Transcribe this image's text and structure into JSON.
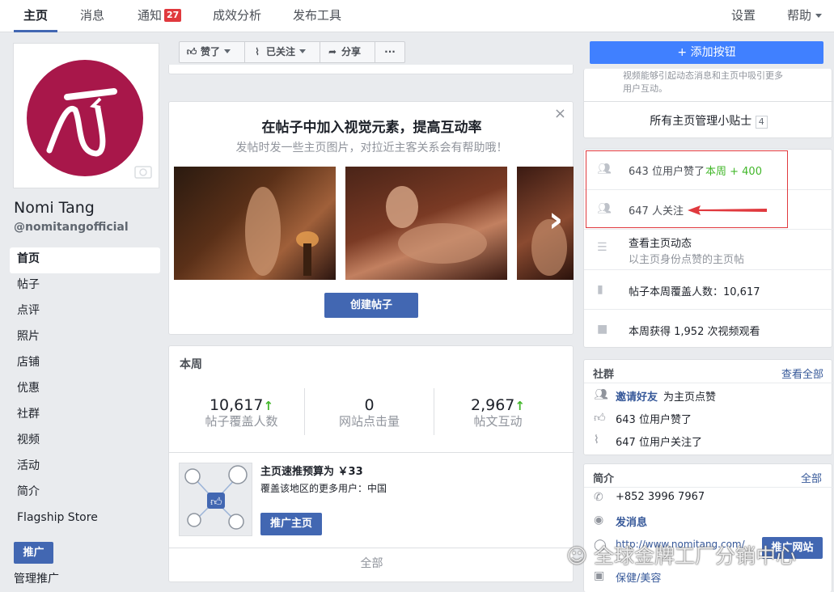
{
  "topnav": {
    "tabs": [
      "主页",
      "消息",
      "通知",
      "成效分析",
      "发布工具"
    ],
    "notif_count": "27",
    "settings": "设置",
    "help": "帮助"
  },
  "page": {
    "name": "Nomi Tang",
    "handle": "@nomitangofficial",
    "nav": [
      "首页",
      "帖子",
      "点评",
      "照片",
      "店铺",
      "优惠",
      "社群",
      "视频",
      "活动",
      "简介",
      "Flagship Store"
    ],
    "promote_button": "推广",
    "manage_promotions": "管理推广"
  },
  "actions": {
    "liked": "赞了",
    "following": "已关注",
    "share": "分享",
    "more": "···"
  },
  "add_button": "+ 添加按钮",
  "visual_card": {
    "title": "在帖子中加入视觉元素，提高互动率",
    "subtitle": "发帖时发一些主页图片，对拉近主客关系会有帮助哦！",
    "create_post": "创建帖子",
    "close": "×",
    "next": "›"
  },
  "week": {
    "header": "本周",
    "stats": [
      {
        "value": "10,617",
        "label": "帖子覆盖人数",
        "up": "↑"
      },
      {
        "value": "0",
        "label": "网站点击量",
        "up": ""
      },
      {
        "value": "2,967",
        "label": "帖文互动",
        "up": "↑"
      }
    ],
    "boost_title": "主页速推预算为 ￥33",
    "boost_desc": "覆盖该地区的更多用户：中国",
    "boost_button": "推广主页",
    "see_all": "全部"
  },
  "tips": {
    "partial_text_1": "视频能够引起动态消息和主页中吸引更多",
    "partial_text_2": "用户互动。",
    "all_tips": "所有主页管理小贴士",
    "tips_count": "4"
  },
  "insights": {
    "likes": "643 位用户赞了",
    "likes_week": "本周 + 400",
    "followers": "647 人关注",
    "activity_title": "查看主页动态",
    "activity_sub": "以主页身份点赞的主页帖",
    "reach": "帖子本周覆盖人数：10,617",
    "video": "本周获得 1,952 次视频观看"
  },
  "community": {
    "header": "社群",
    "see_all": "查看全部",
    "invite": "邀请好友",
    "invite_suffix": "为主页点赞",
    "likes": "643 位用户赞了",
    "follows": "647 位用户关注了"
  },
  "about": {
    "header": "简介",
    "see_all": "全部",
    "phone": "+852 3996 7967",
    "message": "发消息",
    "website": "http://www.nomitang.com/",
    "promote_site": "推广网站",
    "category": "保健/美容"
  },
  "watermark": "全球金牌工厂分销中心",
  "colors": {
    "brand_blue": "#4267b2",
    "add_button": "#4080ff",
    "highlight_red": "#e0393e",
    "logo_red": "#a8174a"
  }
}
